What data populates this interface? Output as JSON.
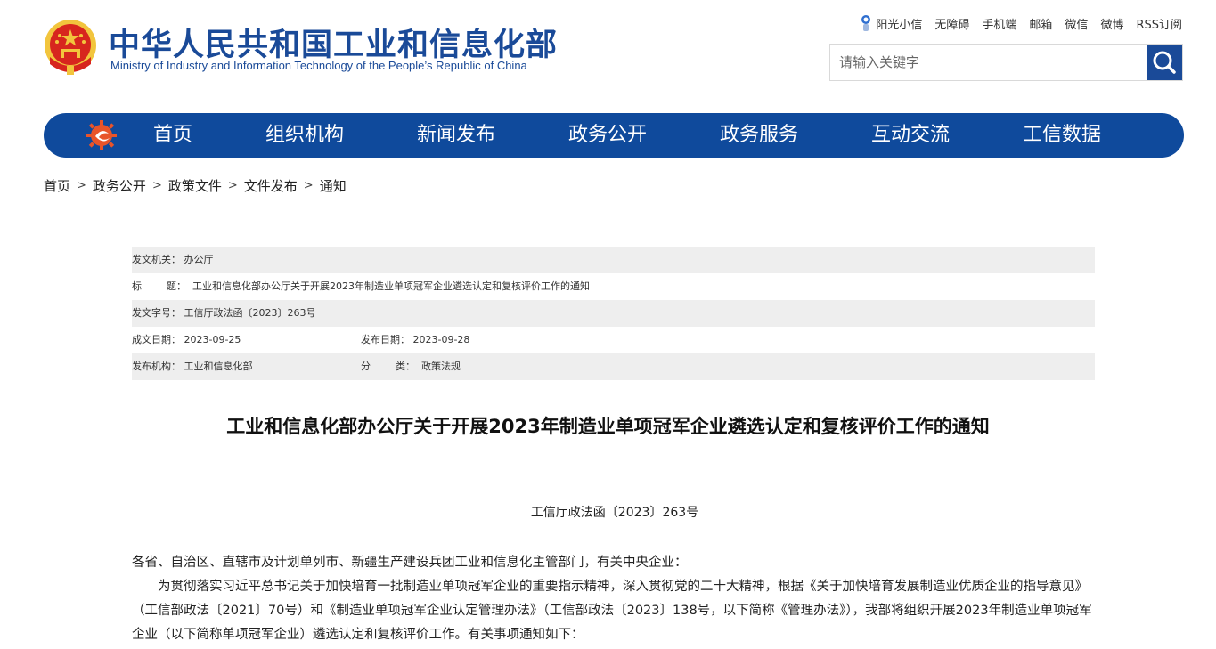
{
  "header": {
    "title_cn": "中华人民共和国工业和信息化部",
    "title_en": "Ministry of Industry and Information Technology of the People’s Republic of China",
    "links": [
      "阳光小信",
      "无障碍",
      "手机端",
      "邮箱",
      "微信",
      "微博",
      "RSS订阅"
    ],
    "search": {
      "placeholder": "请输入关键字"
    }
  },
  "nav": {
    "items": [
      "首页",
      "组织机构",
      "新闻发布",
      "政务公开",
      "政务服务",
      "互动交流",
      "工信数据"
    ]
  },
  "breadcrumb": [
    "首页",
    "政务公开",
    "政策文件",
    "文件发布",
    "通知"
  ],
  "breadcrumb_separator": ">",
  "info": {
    "issuer": "发文机关：  办公厅",
    "title": "标        题：  工业和信息化部办公厅关于开展2023年制造业单项冠军企业遴选认定和复核评价工作的通知",
    "doc_no": "发文字号：  工信厅政法函〔2023〕263号",
    "created": "成文日期：  2023-09-25",
    "published": "发布日期：  2023-09-28",
    "org": "发布机构：  工业和信息化部",
    "category": "分        类：  政策法规"
  },
  "article": {
    "title": "工业和信息化部办公厅关于开展2023年制造业单项冠军企业遴选认定和复核评价工作的通知",
    "doc_number": "工信厅政法函〔2023〕263号",
    "salutation": "各省、自治区、直辖市及计划单列市、新疆生产建设兵团工业和信息化主管部门，有关中央企业：",
    "paragraph1": "为贯彻落实习近平总书记关于加快培育一批制造业单项冠军企业的重要指示精神，深入贯彻党的二十大精神，根据《关于加快培育发展制造业优质企业的指导意见》（工信部政法〔2021〕70号）和《制造业单项冠军企业认定管理办法》（工信部政法〔2023〕138号，以下简称《管理办法》），我部将组织开展2023年制造业单项冠军企业（以下简称单项冠军企业）遴选认定和复核评价工作。有关事项通知如下："
  },
  "colors": {
    "brand_blue": "#1a4a98",
    "nav_blue": "#0f4a9c",
    "emblem_red": "#d7261e",
    "emblem_gold": "#f2c53d"
  }
}
